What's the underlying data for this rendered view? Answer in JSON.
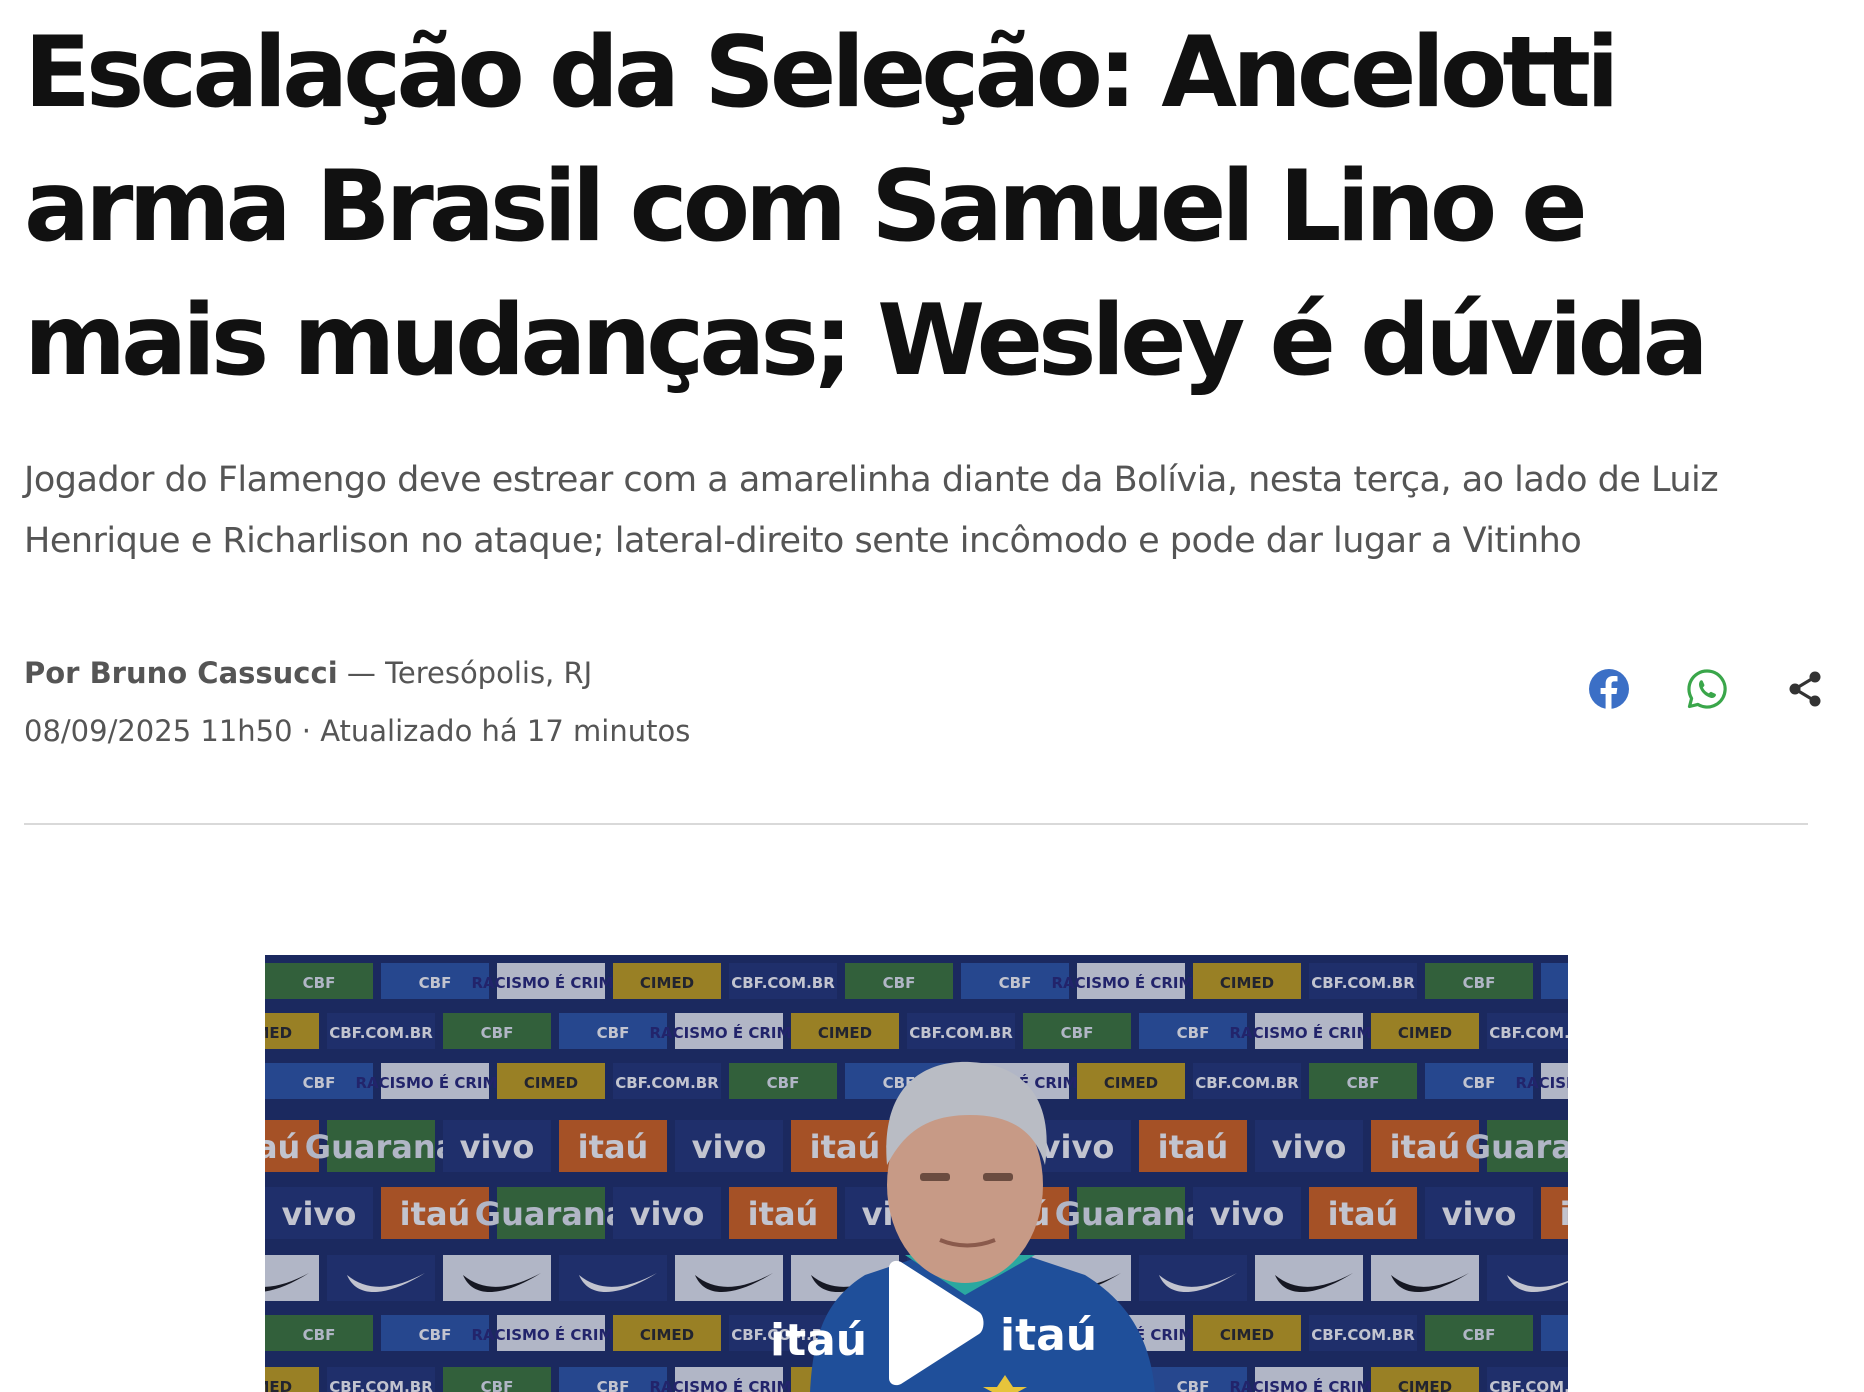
{
  "article": {
    "headline": "Escalação da Seleção: Ancelotti arma Brasil com Samuel Lino e mais mudanças; Wesley é dúvida",
    "subtitle": "Jogador do Flamengo deve estrear com a amarelinha diante da Bolívia, nesta terça, ao lado de Luiz Henrique e Richarlison no ataque; lateral-direito sente incômodo e pode dar lugar a Vitinho",
    "byline": {
      "author": "Por Bruno Cassucci",
      "location": " — Teresópolis, RJ",
      "datetime": "08/09/2025 11h50 · Atualizado há 17 minutos"
    }
  },
  "share": {
    "icons": [
      "facebook-icon",
      "whatsapp-icon",
      "share-icon"
    ],
    "colors": {
      "facebook": "#3b6fc6",
      "whatsapp": "#3aa64a",
      "share": "#333333"
    }
  },
  "video": {
    "sponsor_labels": [
      "CBF",
      "RACISMO É CRIME!",
      "CIMED",
      "CBF.COM.BR",
      "vivo",
      "itaú",
      "Guaraná"
    ],
    "shirt_text": "itaú",
    "colors": {
      "backdrop": "#20306a",
      "green_panel": "#3f7a3a",
      "blue_panel": "#2f58a8",
      "yellow_panel": "#c9a41c",
      "orange_panel": "#d9661e"
    }
  }
}
